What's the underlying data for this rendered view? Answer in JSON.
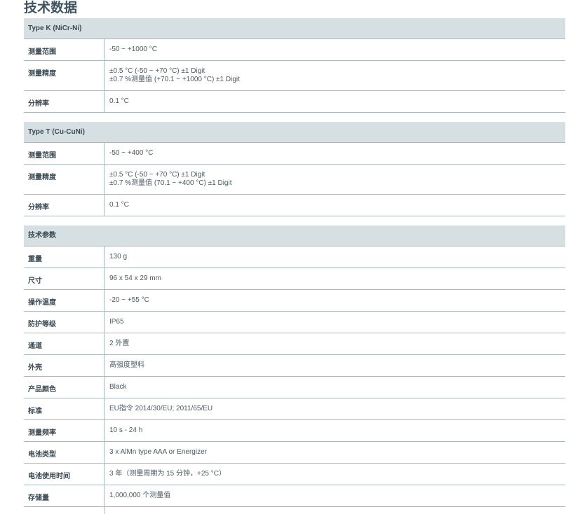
{
  "title": "技术数据",
  "sections": [
    {
      "header": "Type K (NiCr-Ni)",
      "rows": [
        {
          "label": "测量范围",
          "lines": [
            "-50 ~ +1000 °C"
          ]
        },
        {
          "label": "测量精度",
          "lines": [
            "±0.5 °C (-50 ~ +70 °C) ±1 Digit",
            "±0.7 %测量值 (+70.1 ~ +1000 °C) ±1 Digit"
          ]
        },
        {
          "label": "分辨率",
          "lines": [
            "0.1 °C"
          ]
        }
      ]
    },
    {
      "header": "Type T (Cu-CuNi)",
      "rows": [
        {
          "label": "测量范围",
          "lines": [
            "-50 ~ +400 °C"
          ]
        },
        {
          "label": "测量精度",
          "lines": [
            "±0.5 °C (-50 ~ +70 °C) ±1 Digit",
            "±0.7 %测量值 (70.1 ~ +400 °C) ±1 Digit"
          ]
        },
        {
          "label": "分辨率",
          "lines": [
            "0.1 °C"
          ]
        }
      ]
    },
    {
      "header": "技术参数",
      "rows": [
        {
          "label": "重量",
          "lines": [
            "130 g"
          ]
        },
        {
          "label": "尺寸",
          "lines": [
            "96 x 54 x 29 mm"
          ]
        },
        {
          "label": "操作温度",
          "lines": [
            "-20 ~ +55 °C"
          ]
        },
        {
          "label": "防护等级",
          "lines": [
            "IP65"
          ]
        },
        {
          "label": "通道",
          "lines": [
            "2 外置"
          ]
        },
        {
          "label": "外壳",
          "lines": [
            "高强度塑料"
          ]
        },
        {
          "label": "产品颜色",
          "lines": [
            "Black"
          ]
        },
        {
          "label": "标准",
          "lines": [
            "EU指令 2014/30/EU; 2011/65/EU"
          ]
        },
        {
          "label": "测量频率",
          "lines": [
            "10 s - 24 h"
          ]
        },
        {
          "label": "电池类型",
          "lines": [
            "3 x AlMn type AAA or Energizer"
          ]
        },
        {
          "label": "电池使用时间",
          "lines": [
            "3 年（测量周期为 15 分钟，+25 °C）"
          ]
        },
        {
          "label": "存储量",
          "lines": [
            "1,000,000 个测量值"
          ]
        }
      ]
    }
  ]
}
